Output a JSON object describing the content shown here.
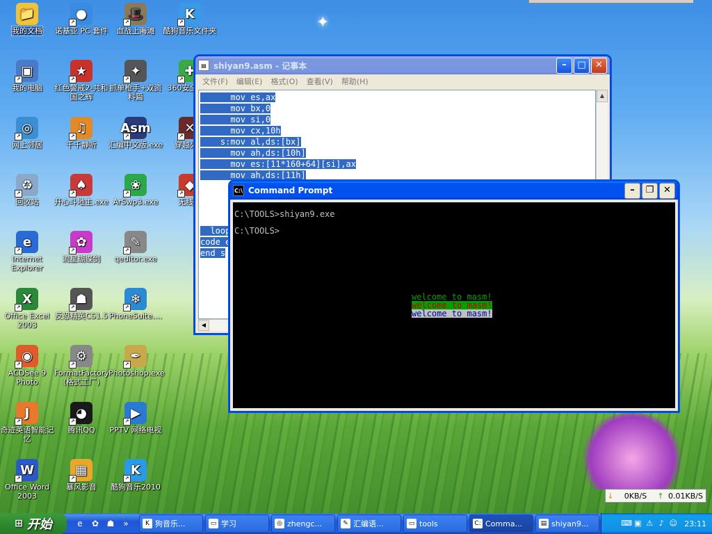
{
  "desktop": {
    "icons": [
      {
        "label": "我的文档",
        "glyph": "📁",
        "color": "#f0c23a"
      },
      {
        "label": "诺基亚 PC 套件",
        "glyph": "●",
        "color": "#3a8be0"
      },
      {
        "label": "血战上海滩",
        "glyph": "🎩",
        "color": "#8a7a5a"
      },
      {
        "label": "酷狗音乐文件夹",
        "glyph": "K",
        "color": "#3b9ae8"
      },
      {
        "label": "我的电脑",
        "glyph": "▣",
        "color": "#4a7ac8"
      },
      {
        "label": "红色警戒2-共和国之辉",
        "glyph": "★",
        "color": "#c8322a"
      },
      {
        "label": "抓单枪手+双资料篇",
        "glyph": "✦",
        "color": "#555555"
      },
      {
        "label": "360安全卫士",
        "glyph": "✚",
        "color": "#3aa845"
      },
      {
        "label": "网上邻居",
        "glyph": "◎",
        "color": "#3a8fd4"
      },
      {
        "label": "千千静听",
        "glyph": "♫",
        "color": "#e08a2a"
      },
      {
        "label": "汇编中文版.exe",
        "glyph": "Asm",
        "color": "#2a3a7a"
      },
      {
        "label": "穿越火线",
        "glyph": "✕",
        "color": "#6a2a2a"
      },
      {
        "label": "回收站",
        "glyph": "♻",
        "color": "#8aa8c8"
      },
      {
        "label": "开心斗地主.exe",
        "glyph": "♠",
        "color": "#c83a3a"
      },
      {
        "label": "ArSwp3.exe",
        "glyph": "❀",
        "color": "#2aa84a"
      },
      {
        "label": "无线网",
        "glyph": "◆",
        "color": "#c83a2a"
      },
      {
        "label": "Internet Explorer",
        "glyph": "e",
        "color": "#2a6ad4"
      },
      {
        "label": "流星蝴蝶剑",
        "glyph": "✿",
        "color": "#c83ac8"
      },
      {
        "label": "qeditor.exe",
        "glyph": "✎",
        "color": "#888888"
      },
      {
        "label": "Office Excel 2003",
        "glyph": "X",
        "color": "#2a8a3a"
      },
      {
        "label": "反恐精英CS1.5",
        "glyph": "☗",
        "color": "#555555"
      },
      {
        "label": "PhoneSuite....",
        "glyph": "❄",
        "color": "#2a8ad4"
      },
      {
        "label": "ACDSee 9 Photo",
        "glyph": "◉",
        "color": "#e05a2a"
      },
      {
        "label": "FormatFactory (格式工厂)",
        "glyph": "⚙",
        "color": "#888888"
      },
      {
        "label": "Photoshop.exe",
        "glyph": "✒",
        "color": "#c8a84a"
      },
      {
        "label": "奇迹英语智能记忆",
        "glyph": "J",
        "color": "#e8782a"
      },
      {
        "label": "腾讯QQ",
        "glyph": "◕",
        "color": "#1a1a1a"
      },
      {
        "label": "PPTV 网络电视",
        "glyph": "▶",
        "color": "#2a7ad4"
      },
      {
        "label": "Office Word 2003",
        "glyph": "W",
        "color": "#2a5ac8"
      },
      {
        "label": "暴风影音",
        "glyph": "▦",
        "color": "#e8a82a"
      },
      {
        "label": "酷狗音乐2010",
        "glyph": "K",
        "color": "#2a9ae8"
      }
    ]
  },
  "notepad": {
    "title": "shiyan9.asm - 记事本",
    "menu": [
      "文件(F)",
      "编辑(E)",
      "格式(O)",
      "查看(V)",
      "帮助(H)"
    ],
    "lines": [
      "      mov es,ax",
      "      mov bx,0",
      "      mov si,0",
      "      mov cx,10h",
      "    s:mov al,ds:[bx]",
      "      mov ah,ds:[10h]",
      "      mov es:[11*160+64][si],ax",
      "      mov ah,ds:[11h]"
    ],
    "tail_lines": [
      "  loop",
      "",
      "",
      "code e",
      "end s"
    ]
  },
  "cmd": {
    "title": "Command Prompt",
    "lines": [
      "C:\\TOOLS>shiyan9.exe",
      "",
      "C:\\TOOLS>"
    ],
    "welcome": [
      {
        "text": "welcome to masm!",
        "fg": "#00a000",
        "bg": "#000000"
      },
      {
        "text": "welcome to masm!",
        "fg": "#c00000",
        "bg": "#00a000"
      },
      {
        "text": "welcome to masm!",
        "fg": "#0000a0",
        "bg": "#c0c0c0"
      }
    ]
  },
  "taskbar": {
    "start": "开始",
    "tasks": [
      {
        "label": "狗音乐...",
        "icon": "K"
      },
      {
        "label": "学习",
        "icon": "▭"
      },
      {
        "label": "zhengc...",
        "icon": "◎"
      },
      {
        "label": "汇编语...",
        "icon": "✎"
      },
      {
        "label": "tools",
        "icon": "▭"
      },
      {
        "label": "Comma...",
        "icon": "C:"
      },
      {
        "label": "shiyan9...",
        "icon": "▤"
      }
    ],
    "clock": "23:11"
  },
  "net": {
    "down": "0KB/S",
    "up": "0.01KB/S"
  }
}
